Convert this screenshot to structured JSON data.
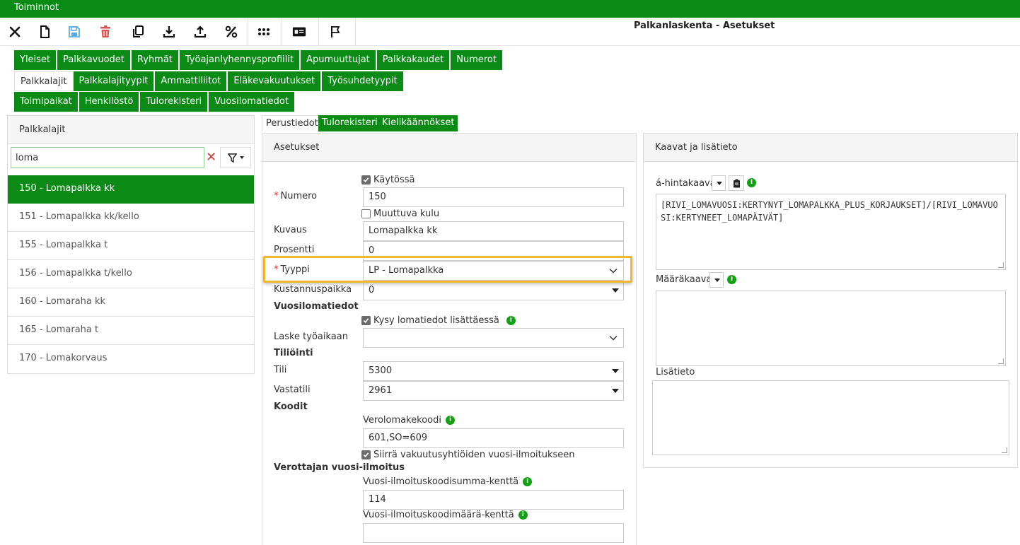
{
  "topbar": {
    "title": "Toiminnot"
  },
  "page_title": "Palkanlaskenta - Asetukset",
  "toolbar": {
    "icons": [
      "close-icon",
      "new-document-icon",
      "save-icon",
      "delete-icon",
      "copy-icon",
      "download-icon",
      "upload-icon",
      "percent-icon",
      "apps-icon",
      "id-card-icon",
      "flag-icon"
    ],
    "colors": {
      "save": "#5aa9e0",
      "delete": "#d9534f"
    }
  },
  "tabs": {
    "row1": [
      "Yleiset",
      "Palkkavuodet",
      "Ryhmät",
      "Työajanlyhennysprofiilit",
      "Apumuuttujat",
      "Palkkakaudet",
      "Numerot"
    ],
    "row2": [
      "Palkkalajit",
      "Palkkalajityypit",
      "Ammattiliitot",
      "Eläkevakuutukset",
      "Työsuhdetyypit"
    ],
    "row3": [
      "Toimipaikat",
      "Henkilöstö",
      "Tulorekisteri",
      "Vuosilomatiedot"
    ]
  },
  "left_panel": {
    "title": "Palkkalajit",
    "search": {
      "value": "loma",
      "placeholder": ""
    },
    "items": [
      "150 - Lomapalkka kk",
      "151 - Lomapalkka kk/kello",
      "155 - Lomapalkka t",
      "156 - Lomapalkka t/kello",
      "160 - Lomaraha kk",
      "165 - Lomaraha t",
      "170 - Lomakorvaus"
    ],
    "selected_index": 0
  },
  "form_tabs": [
    "Perustiedot",
    "Tulorekisteri",
    "Kielikäännökset"
  ],
  "settings": {
    "title": "Asetukset",
    "kaytossa_label": "Käytössä",
    "required_mark": "*",
    "numero_label": "Numero",
    "numero_value": "150",
    "muuttuva_label": "Muuttuva kulu",
    "kuvaus_label": "Kuvaus",
    "kuvaus_value": "Lomapalkka kk",
    "prosentti_label": "Prosentti",
    "prosentti_value": "0",
    "tyyppi_label": "Tyyppi",
    "tyyppi_value": "LP - Lomapalkka",
    "kustannus_label": "Kustannuspaikka",
    "kustannus_value": "0",
    "vuosiloma_section": "Vuosilomatiedot",
    "kysy_label": "Kysy lomatiedot lisättäessä",
    "laske_label": "Laske työaikaan",
    "laske_value": "",
    "tiliointi_section": "Tiliöinti",
    "tili_label": "Tili",
    "tili_value": "5300",
    "vastatili_label": "Vastatili",
    "vastatili_value": "2961",
    "koodit_section": "Koodit",
    "verolomake_label": "Verolomakekoodi",
    "verolomake_value": "601,SO=609",
    "siirra_label": "Siirrä vakuutusyhtiöiden vuosi-ilmoitukseen",
    "verottaja_section": "Verottajan vuosi-ilmoitus",
    "summa_label": "Vuosi-ilmoituskoodisumma-kenttä",
    "summa_value": "114",
    "maara_label": "Vuosi-ilmoituskoodimäärä-kenttä",
    "maara_value": ""
  },
  "right_panel": {
    "title": "Kaavat ja lisätieto",
    "hintakaava_label": "á-hintakaava",
    "hintakaava_value": "[RIVI_LOMAVUOSI:KERTYNYT_LOMAPALKKA_PLUS_KORJAUKSET]/[RIVI_LOMAVUOSI:KERTYNEET_LOMAPÄIVÄT]",
    "maarakaava_label": "Määräkaava",
    "maarakaava_value": "",
    "lisatieto_label": "Lisätieto",
    "lisatieto_value": ""
  },
  "info_glyph": "i",
  "colors": {
    "brand_green": "#0b8a16",
    "highlight": "#efb92b",
    "required": "#d9372c"
  }
}
